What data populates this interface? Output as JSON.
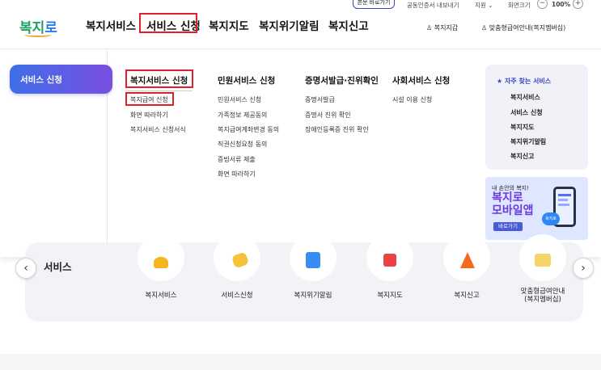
{
  "utility": {
    "skip_link": "본문 바로가기",
    "cert_export": "공동인증서 내보내기",
    "support": "지원",
    "font_size_label": "화면크기",
    "zoom_minus": "−",
    "zoom_value": "100%",
    "zoom_plus": "+"
  },
  "header": {
    "logo_text_a": "복지",
    "logo_text_b": "로",
    "gnb": [
      "복지서비스",
      "서비스 신청",
      "복지지도",
      "복지위기알림",
      "복지신고"
    ],
    "wallet": "복지지갑",
    "membership": "맞춤형급여안내(복지멤버십)"
  },
  "mega": {
    "side_tab": "서비스 신청",
    "columns": [
      {
        "title": "복지서비스 신청",
        "items": [
          "복지급여 신청",
          "화면 따라하기",
          "복지서비스 신청서식"
        ]
      },
      {
        "title": "민원서비스 신청",
        "items": [
          "민원서비스 신청",
          "가족정보 제공동의",
          "복지급여계좌변경 동의",
          "직권신청요청 동의",
          "증빙서류 제출",
          "화면 따라하기"
        ]
      },
      {
        "title": "증명서발급·진위확인",
        "items": [
          "증명서발급",
          "증명서 진위 확인",
          "장애인등록증 진위 확인"
        ]
      },
      {
        "title": "사회서비스 신청",
        "items": [
          "시설 이용 신청"
        ]
      }
    ],
    "favorites": {
      "title": "자주 찾는 서비스",
      "items": [
        "복지서비스",
        "서비스 신청",
        "복지지도",
        "복지위기알림",
        "복지신고"
      ]
    },
    "banner": {
      "line1": "내 손안의 복지!",
      "line2": "복지로",
      "line3": "모바일앱",
      "button": "바로가기",
      "blob": "복지로"
    }
  },
  "services": {
    "title": "서비스",
    "prev": "‹",
    "next": "›",
    "items": [
      "복지서비스",
      "서비스신청",
      "복지위기알림",
      "복지지도",
      "복지신고",
      "맞춤형급여안내",
      "(복지멤버십)"
    ]
  },
  "colors": {
    "accent": "#3f6ee8",
    "highlight_box": "#e0202a",
    "logo_blue": "#2a7de1",
    "logo_green": "#22a060"
  }
}
